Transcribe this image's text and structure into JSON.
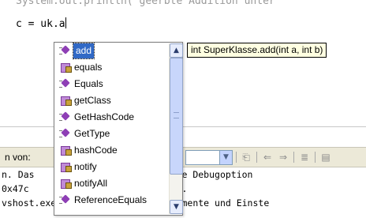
{
  "editor": {
    "line1": "System.out.println(\"geerbte Addition unter",
    "line2_prefix": "c = uk.a"
  },
  "autocomplete": {
    "items": [
      {
        "label": "add",
        "icon": "public-method-icon",
        "selected": true
      },
      {
        "label": "equals",
        "icon": "protected-method-icon"
      },
      {
        "label": "Equals",
        "icon": "public-method-icon"
      },
      {
        "label": "getClass",
        "icon": "protected-method-icon"
      },
      {
        "label": "GetHashCode",
        "icon": "public-method-icon"
      },
      {
        "label": "GetType",
        "icon": "public-method-icon"
      },
      {
        "label": "hashCode",
        "icon": "protected-method-icon"
      },
      {
        "label": "notify",
        "icon": "protected-method-icon"
      },
      {
        "label": "notifyAll",
        "icon": "protected-method-icon"
      },
      {
        "label": "ReferenceEquals",
        "icon": "public-method-icon"
      }
    ],
    "tooltip": "int SuperKlasse.add(int a, int b)"
  },
  "output_toolbar": {
    "show_output_from_label": "n von:"
  },
  "output": {
    "lines": [
      "n. Das                 rt, und die Debugoption",
      "0x47c                  0) geendet.",
      "vshost.exe  (verwaltet): \"C:\\Dokumente und Einste"
    ]
  },
  "colors": {
    "selection": "#3169c6",
    "tooltip_bg": "#ffffe1",
    "toolbar_bg": "#ece9d8"
  }
}
